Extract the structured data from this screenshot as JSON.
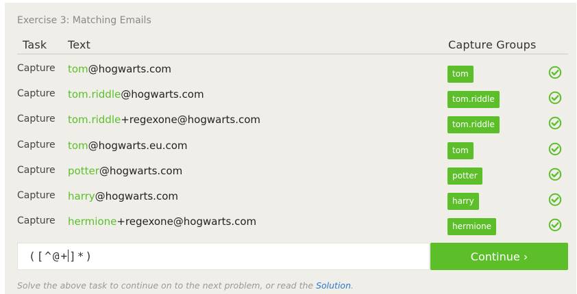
{
  "exercise_title": "Exercise 3: Matching Emails",
  "table": {
    "headers": {
      "task": "Task",
      "text": "Text",
      "groups": "Capture Groups"
    },
    "rows": [
      {
        "task": "Capture",
        "match": "tom",
        "rest": "@hogwarts.com",
        "group": "tom",
        "status_icon": "check-circle-icon"
      },
      {
        "task": "Capture",
        "match": "tom.riddle",
        "rest": "@hogwarts.com",
        "group": "tom.riddle",
        "status_icon": "check-circle-icon"
      },
      {
        "task": "Capture",
        "match": "tom.riddle",
        "rest": "+regexone@hogwarts.com",
        "group": "tom.riddle",
        "status_icon": "check-circle-icon"
      },
      {
        "task": "Capture",
        "match": "tom",
        "rest": "@hogwarts.eu.com",
        "group": "tom",
        "status_icon": "check-circle-icon"
      },
      {
        "task": "Capture",
        "match": "potter",
        "rest": "@hogwarts.com",
        "group": "potter",
        "status_icon": "check-circle-icon"
      },
      {
        "task": "Capture",
        "match": "harry",
        "rest": "@hogwarts.com",
        "group": "harry",
        "status_icon": "check-circle-icon"
      },
      {
        "task": "Capture",
        "match": "hermione",
        "rest": "+regexone@hogwarts.com",
        "group": "hermione",
        "status_icon": "check-circle-icon"
      }
    ]
  },
  "input": {
    "value_before_caret": "([^@+",
    "value_after_caret": "]*)"
  },
  "continue_label": "Continue ›",
  "footer": {
    "text": "Solve the above task to continue on to the next problem, or read the ",
    "link": "Solution",
    "end": "."
  },
  "colors": {
    "accent": "#5cbf2a",
    "link": "#2a77c9",
    "panel": "#efeee9"
  }
}
